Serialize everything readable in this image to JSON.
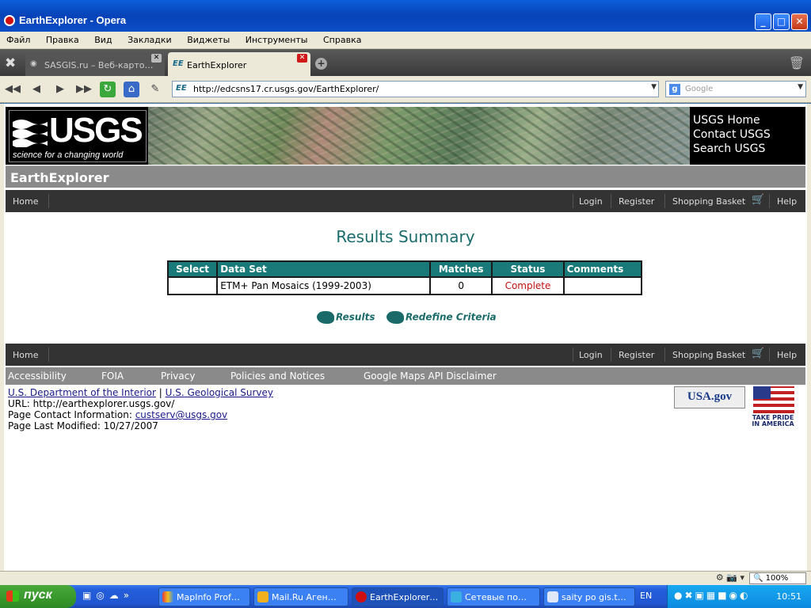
{
  "window": {
    "title": "EarthExplorer - Opera"
  },
  "menu": [
    "Файл",
    "Правка",
    "Вид",
    "Закладки",
    "Виджеты",
    "Инструменты",
    "Справка"
  ],
  "tabs": [
    {
      "label": "SASGIS.ru – Веб-карто…"
    },
    {
      "label": "EarthExplorer"
    }
  ],
  "address": {
    "url": "http://edcsns17.cr.usgs.gov/EarthExplorer/",
    "site_badge": "EE"
  },
  "search": {
    "placeholder": "Google"
  },
  "banner": {
    "logo_text": "USGS",
    "tagline": "science for a changing world",
    "links": [
      "USGS Home",
      "Contact USGS",
      "Search USGS"
    ]
  },
  "app_title": "EarthExplorer",
  "nav": {
    "home": "Home",
    "login": "Login",
    "register": "Register",
    "basket": "Shopping Basket",
    "help": "Help"
  },
  "results": {
    "heading": "Results Summary",
    "columns": [
      "Select",
      "Data Set",
      "Matches",
      "Status",
      "Comments"
    ],
    "rows": [
      {
        "select": "",
        "dataset": "ETM+ Pan Mosaics (1999-2003)",
        "matches": "0",
        "status": "Complete",
        "comments": ""
      }
    ],
    "buttons": {
      "results": "Results",
      "redefine": "Redefine Criteria"
    }
  },
  "footer_links": [
    "Accessibility",
    "FOIA",
    "Privacy",
    "Policies and Notices",
    "Google Maps API Disclaimer"
  ],
  "footer_info": {
    "doi": "U.S. Department of the Interior",
    "sep": "|",
    "usgs": "U.S. Geological Survey",
    "url_line": "URL: http://earthexplorer.usgs.gov/",
    "contact_label": "Page Contact Information:",
    "contact_email": "custserv@usgs.gov",
    "modified": "Page Last Modified: 10/27/2007"
  },
  "badges": {
    "usagov": "USA.gov",
    "pride": "TAKE PRIDE IN AMERICA"
  },
  "statusbar": {
    "zoom": "100%"
  },
  "taskbar": {
    "start": "пуск",
    "tasks": [
      "MapInfo Prof…",
      "Mail.Ru Аген…",
      "EarthExplorer…",
      "Сетевые по…",
      "saity po gis.t…"
    ],
    "lang": "EN",
    "clock": "10:51"
  },
  "colors": {
    "teal": "#1a7a7a",
    "status_complete": "#c01010",
    "dark_nav": "#333333",
    "gray_bar": "#8a8a8a"
  }
}
